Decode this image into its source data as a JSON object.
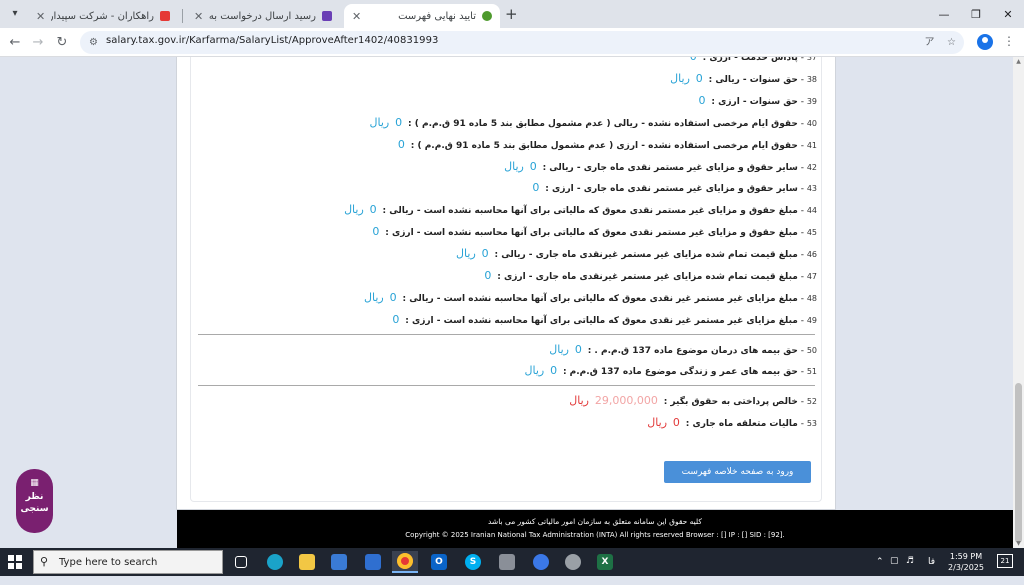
{
  "browser": {
    "tabs": [
      {
        "title": "راهکاران - شرکت سپیدار سیستم آ...",
        "fav_color": "#e53935",
        "active": false
      },
      {
        "title": "رسید ارسال درخواست به کارپوشه",
        "fav_color": "#6a3fb5",
        "active": false
      },
      {
        "title": "تایید نهایی فهرست",
        "fav_color": "#4e9a2d",
        "active": true
      }
    ],
    "tab_list_icon": "▾",
    "close_glyph": "✕",
    "new_tab_glyph": "+",
    "window_controls": [
      "—",
      "❐",
      "✕"
    ],
    "url": "salary.tax.gov.ir/Karfarma/SalaryList/ApproveAfter1402/40831993"
  },
  "page": {
    "rows": [
      {
        "num": "37",
        "label": "پاداش خدمت - ارزی :",
        "value": "0",
        "unit": "",
        "style": "blue"
      },
      {
        "num": "38",
        "label": "حق سنوات - ریالی :",
        "value": "0",
        "unit": "ریال",
        "style": "blue"
      },
      {
        "num": "39",
        "label": "حق سنوات - ارزی :",
        "value": "0",
        "unit": "",
        "style": "blue"
      },
      {
        "num": "40",
        "label": "حقوق ایام مرخصی استفاده نشده - ریالی ( عدم مشمول مطابق بند 5 ماده 91 ق.م.م ) :",
        "value": "0",
        "unit": "ریال",
        "style": "blue"
      },
      {
        "num": "41",
        "label": "حقوق ایام مرخصی استفاده نشده - ارزی ( عدم مشمول مطابق بند 5 ماده 91 ق.م.م ) :",
        "value": "0",
        "unit": "",
        "style": "blue"
      },
      {
        "num": "42",
        "label": "سایر حقوق و مزایای غیر مستمر نقدی ماه جاری - ریالی :",
        "value": "0",
        "unit": "ریال",
        "style": "blue"
      },
      {
        "num": "43",
        "label": "سایر حقوق و مزایای غیر مستمر نقدی ماه جاری - ارزی :",
        "value": "0",
        "unit": "",
        "style": "blue"
      },
      {
        "num": "44",
        "label": "مبلغ حقوق و مزایای غیر مستمر نقدی معوق که مالیاتی برای آنها محاسبه نشده است - ریالی :",
        "value": "0",
        "unit": "ریال",
        "style": "blue"
      },
      {
        "num": "45",
        "label": "مبلغ حقوق و مزایای غیر مستمر نقدی معوق که مالیاتی برای آنها محاسبه نشده است - ارزی :",
        "value": "0",
        "unit": "",
        "style": "blue"
      },
      {
        "num": "46",
        "label": "مبلغ قیمت تمام شده مزایای غیر مستمر غیرنقدی ماه جاری - ریالی :",
        "value": "0",
        "unit": "ریال",
        "style": "blue"
      },
      {
        "num": "47",
        "label": "مبلغ قیمت تمام شده مزایای غیر مستمر غیرنقدی ماه جاری - ارزی :",
        "value": "0",
        "unit": "",
        "style": "blue"
      },
      {
        "num": "48",
        "label": "مبلغ مزایای غیر مستمر غیر نقدی معوق که مالیاتی برای آنها محاسبه نشده است - ریالی :",
        "value": "0",
        "unit": "ریال",
        "style": "blue"
      },
      {
        "num": "49",
        "label": "مبلغ مزایای غیر مستمر غیر نقدی معوق که مالیاتی برای آنها محاسبه نشده است - ارزی :",
        "value": "0",
        "unit": "",
        "style": "blue"
      },
      {
        "num": "50",
        "label": "حق بیمه های درمان موضوع ماده 137 ق.م.م . :",
        "value": "0",
        "unit": "ریال",
        "style": "blue"
      },
      {
        "num": "51",
        "label": "حق بیمه های عمر و زندگی موضوع ماده 137 ق.م.م :",
        "value": "0",
        "unit": "ریال",
        "style": "blue"
      },
      {
        "num": "52",
        "label": "خالص پرداختی به حقوق بگیر :",
        "value": "29,000,000",
        "unit": "ریال",
        "style": "blurred"
      },
      {
        "num": "53",
        "label": "مالیات متعلقه ماه جاری :",
        "value": "0",
        "unit": "ریال",
        "style": "red"
      }
    ],
    "summary_button": "ورود به صفحه خلاصه فهرست",
    "feedback": {
      "line1": "نظر",
      "line2": "سنجی",
      "icon": "bar-chart-icon"
    },
    "footer": {
      "line1": "کلیه حقوق این سامانه متعلق به سازمان امور مالیاتی کشور می باشد",
      "line2": "Copyright © 2025 Iranian National Tax Administration (INTA) All rights reserved Browser : [] IP : [] SID : [92]."
    }
  },
  "taskbar": {
    "search_placeholder": "Type here to search",
    "time": "1:59 PM",
    "date": "2/3/2025",
    "lang": "فا",
    "notification_count": "21",
    "accent": "#7ab4f5"
  }
}
